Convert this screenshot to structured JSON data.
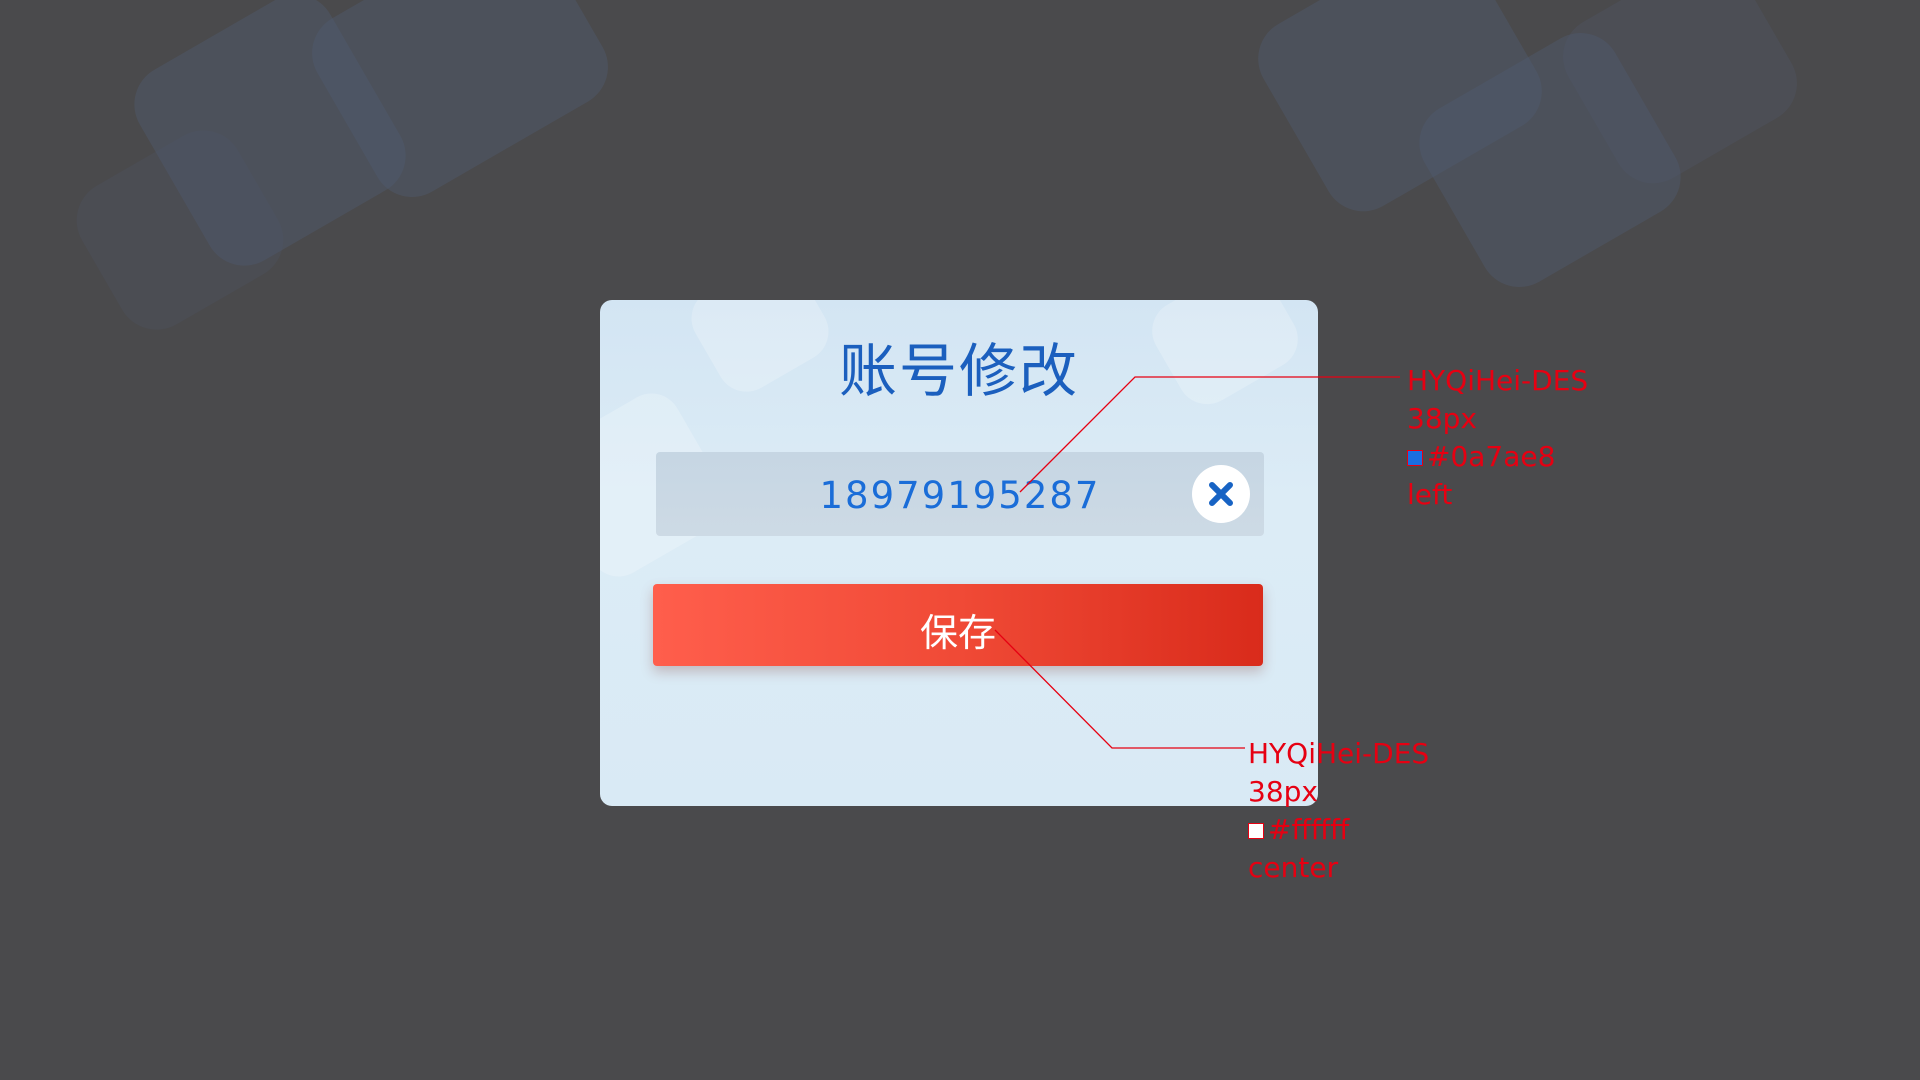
{
  "dialog": {
    "title": "账号修改",
    "input_value": "18979195287",
    "save_label": "保存"
  },
  "annotations": [
    {
      "font": "HYQiHei-DES",
      "size": "38px",
      "color_label": "#0a7ae8",
      "swatch_color": "#1a6ee0",
      "align": "left"
    },
    {
      "font": "HYQiHei-DES",
      "size": "38px",
      "color_label": "#ffffff",
      "swatch_color": "#ffffff",
      "align": "center"
    }
  ],
  "icons": {
    "clear": "close-icon"
  },
  "colors": {
    "title": "#1b5fbe",
    "input_text": "#1a6dd8",
    "button_start": "#ff5e4c",
    "button_end": "#d92b1b",
    "annotation": "#e60012"
  }
}
